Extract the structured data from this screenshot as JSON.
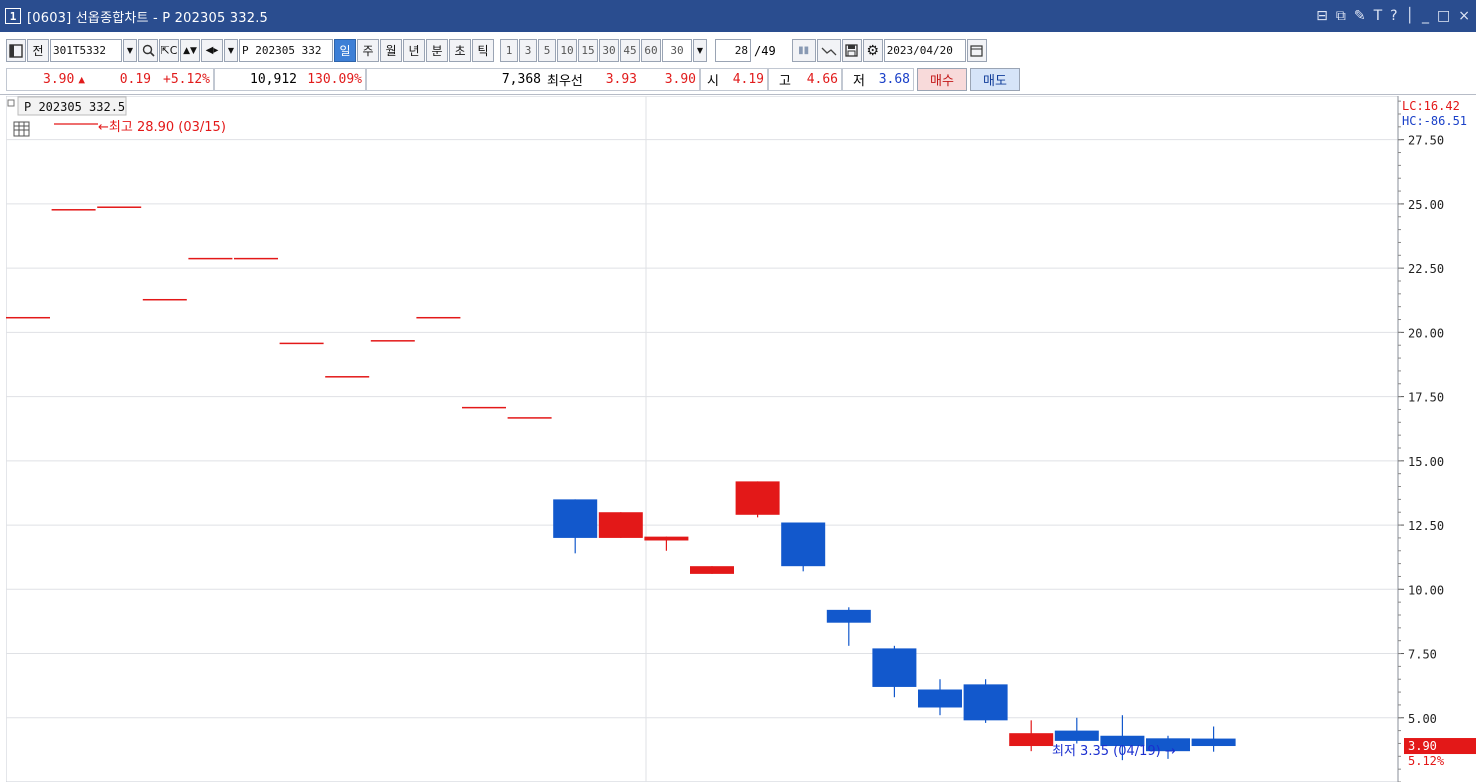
{
  "window": {
    "number": "1",
    "title": "[0603] 선옵종합차트 - P 202305 332.5",
    "controls": [
      "⊟",
      "⧉",
      "✎",
      "T",
      "?",
      "│",
      "_",
      "□",
      "×"
    ]
  },
  "toolbar": {
    "prefix_label": "전",
    "code_value": "301T5332",
    "name_value": "P 202305 332",
    "periods": [
      {
        "label": "일",
        "selected": true
      },
      {
        "label": "주",
        "selected": false
      },
      {
        "label": "월",
        "selected": false
      },
      {
        "label": "년",
        "selected": false
      },
      {
        "label": "분",
        "selected": false
      },
      {
        "label": "초",
        "selected": false
      },
      {
        "label": "틱",
        "selected": false
      }
    ],
    "intervals": [
      "1",
      "3",
      "5",
      "10",
      "15",
      "30",
      "45",
      "60"
    ],
    "interval_value": "30",
    "count_value": "28",
    "count_total": "/49",
    "date_value": "2023/04/20"
  },
  "quote": {
    "price": "3.90",
    "change_arrow": "▲",
    "change": "0.19",
    "change_pct": "+5.12%",
    "volume": "10,912",
    "volume_pct": "130.09%",
    "best_qty": "7,368",
    "best_label": "최우선",
    "best_ask": "3.93",
    "best_bid": "3.90",
    "open_label": "시",
    "open": "4.19",
    "high_label": "고",
    "high": "4.66",
    "low_label": "저",
    "low": "3.68",
    "buy_label": "매수",
    "sell_label": "매도"
  },
  "chart_data": {
    "type": "candlestick",
    "legend": "P 202305 332.5",
    "ylim": [
      2.5,
      29.2
    ],
    "yticks": [
      "27.50",
      "25.00",
      "22.50",
      "20.00",
      "17.50",
      "15.00",
      "12.50",
      "10.00",
      "7.50",
      "5.00"
    ],
    "ytick_values": [
      27.5,
      25,
      22.5,
      20,
      17.5,
      15,
      12.5,
      10,
      7.5,
      5
    ],
    "lc_label": "LC:16.42",
    "hc_label": "HC:-86.51",
    "last_price_label": "3.90",
    "last_pct_label": "5.12%",
    "last_price": 3.9,
    "colors": {
      "up": "#e31818",
      "down": "#1258cc",
      "grid": "#dfe1e5"
    },
    "max_annotation": "←최고 28.90 (03/15)",
    "min_annotation": "최저 3.35 (04/19) →",
    "candles": [
      {
        "o": 20.6,
        "h": 20.6,
        "l": 20.6,
        "c": 20.6
      },
      {
        "o": 24.8,
        "h": 24.8,
        "l": 24.8,
        "c": 24.8
      },
      {
        "o": 24.9,
        "h": 24.9,
        "l": 24.9,
        "c": 24.9
      },
      {
        "o": 21.3,
        "h": 21.3,
        "l": 21.3,
        "c": 21.3
      },
      {
        "o": 22.9,
        "h": 22.9,
        "l": 22.9,
        "c": 22.9
      },
      {
        "o": 22.9,
        "h": 22.9,
        "l": 22.9,
        "c": 22.9
      },
      {
        "o": 19.6,
        "h": 19.6,
        "l": 19.6,
        "c": 19.6
      },
      {
        "o": 18.3,
        "h": 18.3,
        "l": 18.3,
        "c": 18.3
      },
      {
        "o": 19.7,
        "h": 19.7,
        "l": 19.7,
        "c": 19.7
      },
      {
        "o": 20.6,
        "h": 20.6,
        "l": 20.6,
        "c": 20.6
      },
      {
        "o": 17.1,
        "h": 17.1,
        "l": 17.1,
        "c": 17.1
      },
      {
        "o": 16.7,
        "h": 16.7,
        "l": 16.7,
        "c": 16.7
      },
      {
        "o": 13.5,
        "h": 13.5,
        "l": 11.4,
        "c": 12.0
      },
      {
        "o": 12.0,
        "h": 13.0,
        "l": 12.0,
        "c": 13.0
      },
      {
        "o": 11.9,
        "h": 12.05,
        "l": 11.5,
        "c": 12.05
      },
      {
        "o": 10.6,
        "h": 10.9,
        "l": 10.6,
        "c": 10.9
      },
      {
        "o": 12.9,
        "h": 14.2,
        "l": 12.8,
        "c": 14.2
      },
      {
        "o": 12.6,
        "h": 12.6,
        "l": 10.7,
        "c": 10.9
      },
      {
        "o": 9.2,
        "h": 9.3,
        "l": 7.8,
        "c": 8.7
      },
      {
        "o": 7.7,
        "h": 7.8,
        "l": 5.8,
        "c": 6.2
      },
      {
        "o": 6.1,
        "h": 6.5,
        "l": 5.1,
        "c": 5.4
      },
      {
        "o": 6.3,
        "h": 6.5,
        "l": 4.8,
        "c": 4.9
      },
      {
        "o": 3.9,
        "h": 4.9,
        "l": 3.7,
        "c": 4.4
      },
      {
        "o": 4.5,
        "h": 5.0,
        "l": 4.0,
        "c": 4.1
      },
      {
        "o": 4.3,
        "h": 5.1,
        "l": 3.35,
        "c": 3.9
      },
      {
        "o": 4.2,
        "h": 4.3,
        "l": 3.4,
        "c": 3.7
      },
      {
        "o": 4.19,
        "h": 4.66,
        "l": 3.68,
        "c": 3.9
      }
    ]
  }
}
